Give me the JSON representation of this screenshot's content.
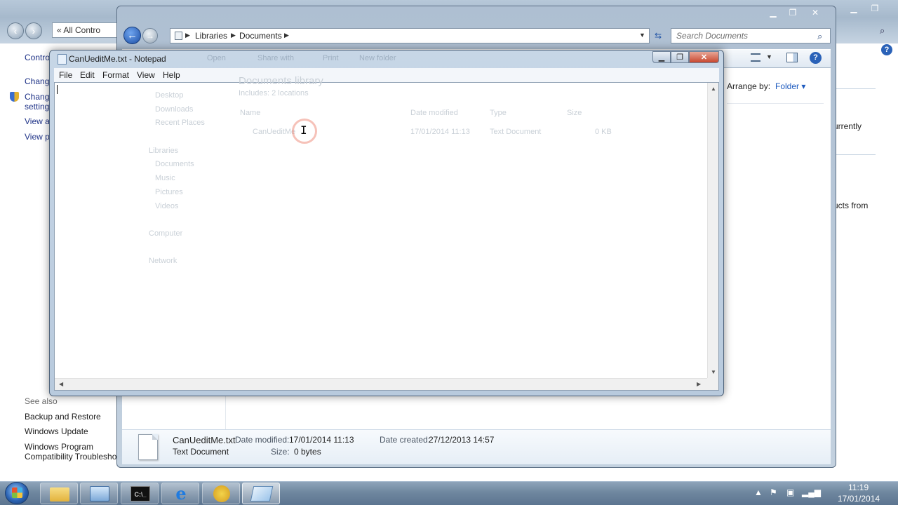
{
  "control_panel": {
    "address_text": "« All Contro",
    "left_links": [
      {
        "label": "Control"
      },
      {
        "label": "Change"
      },
      {
        "label": "Change"
      },
      {
        "label": "settings"
      },
      {
        "label": "View archived messages"
      },
      {
        "label": "View performance information"
      }
    ],
    "see_also_label": "See also",
    "see_also": [
      {
        "label": "Backup and Restore"
      },
      {
        "label": "Windows Update"
      },
      {
        "label": "Windows Program"
      },
      {
        "label": "Compatibility Troubleshooter"
      }
    ],
    "right_fragments": [
      "urrently",
      "ucts from"
    ]
  },
  "explorer": {
    "breadcrumb": [
      "Libraries",
      "Documents"
    ],
    "search_placeholder": "Search Documents",
    "toolbar": [
      "Open",
      "Share with",
      "Print",
      "New folder"
    ],
    "arrange_label": "Arrange by:",
    "arrange_value": "Folder",
    "library_title": "Documents library",
    "library_sub": "Includes: 2 locations",
    "nav": {
      "favorites": [
        "Desktop",
        "Downloads",
        "Recent Places"
      ],
      "libraries_label": "Libraries",
      "libraries": [
        "Documents",
        "Music",
        "Pictures",
        "Videos"
      ],
      "computer": "Computer",
      "network": "Network"
    },
    "columns": [
      "Name",
      "Date modified",
      "Type",
      "Size"
    ],
    "file_row": {
      "name": "CanUeditMe",
      "date": "17/01/2014 11:13",
      "type": "Text Document",
      "size": "0 KB"
    },
    "details": {
      "filename": "CanUeditMe.txt",
      "filetype": "Text Document",
      "date_modified_label": "Date modified:",
      "date_modified": "17/01/2014 11:13",
      "date_created_label": "Date created:",
      "date_created": "27/12/2013 14:57",
      "size_label": "Size:",
      "size": "0 bytes"
    }
  },
  "notepad": {
    "title": "CanUeditMe.txt - Notepad",
    "menu": [
      "File",
      "Edit",
      "Format",
      "View",
      "Help"
    ],
    "content": ""
  },
  "taskbar": {
    "apps": [
      {
        "icon": "folder-icon"
      },
      {
        "icon": "control-panel-icon"
      },
      {
        "icon": "command-prompt-icon"
      },
      {
        "icon": "internet-explorer-icon"
      },
      {
        "icon": "network-globe-icon"
      },
      {
        "icon": "notepad-icon"
      }
    ],
    "time": "11:19",
    "date": "17/01/2014"
  },
  "colors": {
    "link": "#1e3287",
    "accent_blue": "#1e5bbf",
    "close_red": "#c8472e"
  }
}
